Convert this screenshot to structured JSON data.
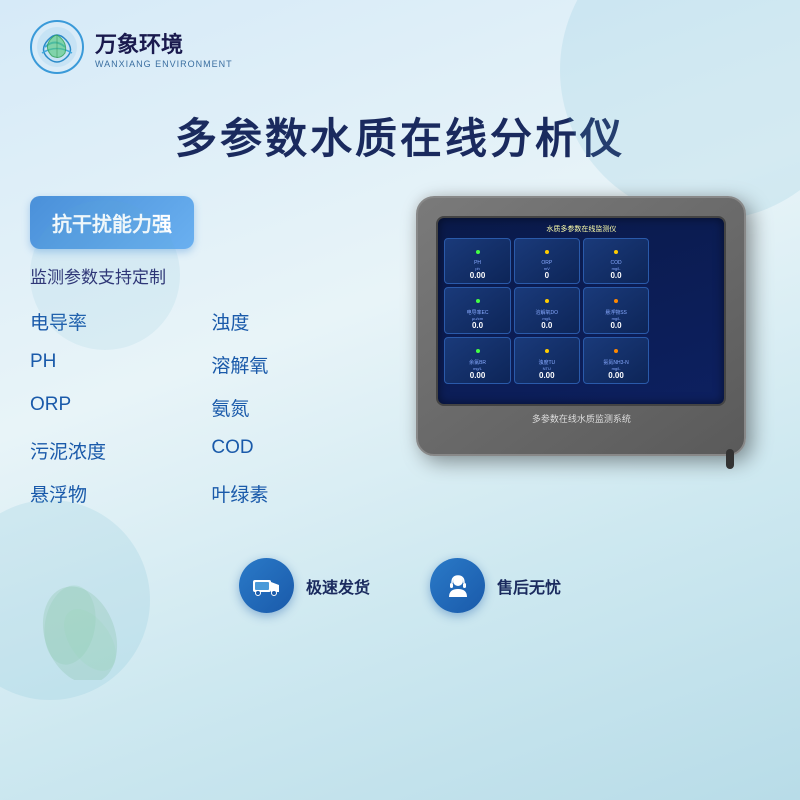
{
  "brand": {
    "logo_main": "万象环境",
    "logo_sub": "WANXIANG ENVIRONMENT"
  },
  "main_title": "多参数水质在线分析仪",
  "left_panel": {
    "badge": "抗干扰能力强",
    "subtitle": "监测参数支持定制",
    "features": [
      {
        "label": "电导率"
      },
      {
        "label": "浊度"
      },
      {
        "label": "PH"
      },
      {
        "label": "溶解氧"
      },
      {
        "label": "ORP"
      },
      {
        "label": "氨氮"
      },
      {
        "label": "污泥浓度"
      },
      {
        "label": "COD"
      },
      {
        "label": "悬浮物"
      },
      {
        "label": "叶绿素"
      }
    ]
  },
  "device": {
    "screen_title": "水质多参数在线监测仪",
    "bottom_label": "多参数在线水质监测系统",
    "cells": [
      {
        "label": "PH",
        "unit": "ph",
        "value": "0.00",
        "dot": "green"
      },
      {
        "label": "ORP",
        "unit": "mV",
        "value": "0",
        "dot": "yellow"
      },
      {
        "label": "COD",
        "unit": "mg/L",
        "value": "0.0",
        "dot": "yellow"
      },
      {
        "label": "",
        "unit": "",
        "value": "",
        "dot": ""
      },
      {
        "label": "电导率EC",
        "unit": "μu/cm",
        "value": "0.0",
        "dot": "green"
      },
      {
        "label": "溶解氧DO",
        "unit": "mg/L",
        "value": "0.0",
        "dot": "yellow"
      },
      {
        "label": "悬浮物SS",
        "unit": "mg/L",
        "value": "0.0",
        "dot": "orange"
      },
      {
        "label": "",
        "unit": "",
        "value": "",
        "dot": ""
      },
      {
        "label": "余氯BR",
        "unit": "mg/L",
        "value": "0.00",
        "dot": "green"
      },
      {
        "label": "浊度TU",
        "unit": "NTU",
        "value": "0.00",
        "dot": "yellow"
      },
      {
        "label": "氨氮NH3-N",
        "unit": "mg/L",
        "value": "0.00",
        "dot": "orange"
      },
      {
        "label": "",
        "unit": "",
        "value": "",
        "dot": ""
      }
    ]
  },
  "bottom_items": [
    {
      "icon": "truck",
      "text": "极速发货"
    },
    {
      "icon": "person",
      "text": "售后无忧"
    }
  ]
}
